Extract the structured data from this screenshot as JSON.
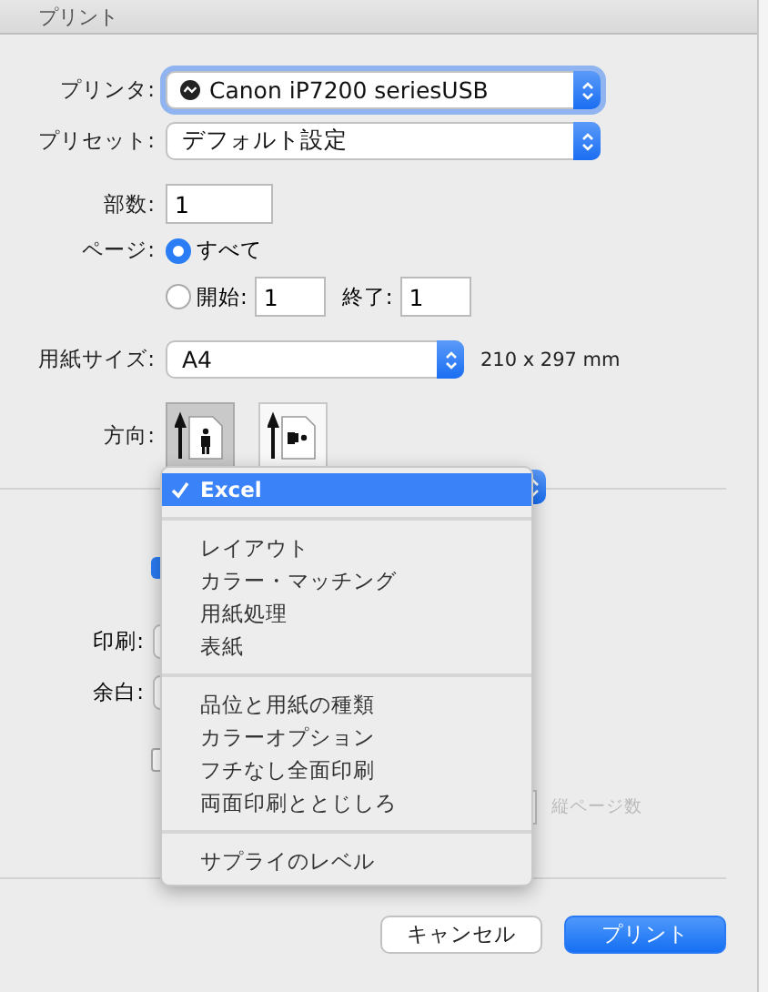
{
  "window": {
    "title": "プリント"
  },
  "printer": {
    "label": "プリンタ:",
    "value": "Canon iP7200 seriesUSB"
  },
  "preset": {
    "label": "プリセット:",
    "value": "デフォルト設定"
  },
  "copies": {
    "label": "部数:",
    "value": "1"
  },
  "pages": {
    "label": "ページ:",
    "options": [
      {
        "label": "すべて",
        "selected": true
      },
      {
        "label": "開始:",
        "selected": false
      }
    ],
    "from": "1",
    "to_label": "終了:",
    "to": "1"
  },
  "paper_size": {
    "label": "用紙サイズ:",
    "value": "A4",
    "dimensions": "210 x 297 mm"
  },
  "orientation": {
    "label": "方向:",
    "options": [
      {
        "kind": "portrait",
        "selected": true
      },
      {
        "kind": "landscape",
        "selected": false
      }
    ]
  },
  "background_fields": {
    "print_label": "印刷:",
    "margin_label": "余白:",
    "checkbox_checked": true,
    "second_checkbox_checked": false,
    "pages_down_label": "縦ページ数"
  },
  "menu": {
    "sections": [
      {
        "items": [
          {
            "label": "Excel",
            "selected": true
          }
        ]
      },
      {
        "items": [
          {
            "label": "レイアウト",
            "selected": false
          },
          {
            "label": "カラー・マッチング",
            "selected": false
          },
          {
            "label": "用紙処理",
            "selected": false
          },
          {
            "label": "表紙",
            "selected": false
          }
        ]
      },
      {
        "items": [
          {
            "label": "品位と用紙の種類",
            "selected": false
          },
          {
            "label": "カラーオプション",
            "selected": false
          },
          {
            "label": "フチなし全面印刷",
            "selected": false
          },
          {
            "label": "両面印刷ととじしろ",
            "selected": false
          }
        ]
      },
      {
        "items": [
          {
            "label": "サプライのレベル",
            "selected": false
          }
        ]
      }
    ]
  },
  "buttons": [
    {
      "label": "キャンセル",
      "kind": "secondary"
    },
    {
      "label": "プリント",
      "kind": "primary"
    }
  ]
}
